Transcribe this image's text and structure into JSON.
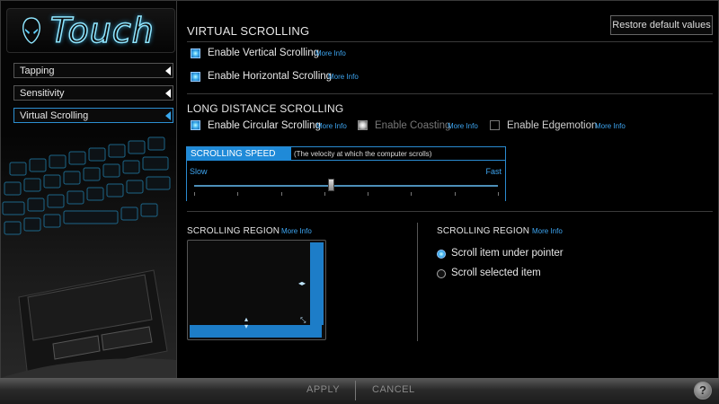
{
  "app": {
    "logo_text": "Touch"
  },
  "sidebar": {
    "items": [
      {
        "label": "Tapping"
      },
      {
        "label": "Sensitivity"
      },
      {
        "label": "Virtual Scrolling"
      }
    ]
  },
  "header": {
    "title": "VIRTUAL SCROLLING",
    "restore_label": "Restore default values"
  },
  "virtual": {
    "vertical": {
      "label": "Enable Vertical Scrolling",
      "checked": true,
      "more": "More Info"
    },
    "horizontal": {
      "label": "Enable Horizontal Scrolling",
      "checked": true,
      "more": "More Info"
    }
  },
  "long_distance": {
    "title": "LONG DISTANCE SCROLLING",
    "circular": {
      "label": "Enable Circular Scrolling",
      "checked": true,
      "more": "More Info"
    },
    "coasting": {
      "label": "Enable Coasting",
      "checked": true,
      "disabled": true,
      "more": "More Info"
    },
    "edgemotion": {
      "label": "Enable Edgemotion",
      "checked": false,
      "more": "More Info"
    }
  },
  "speed": {
    "title": "SCROLLING SPEED",
    "description": "(The velocity at which the computer scrolls)",
    "min_label": "Slow",
    "max_label": "Fast",
    "value": 0.45,
    "ticks": 8
  },
  "region_left": {
    "title": "SCROLLING REGION",
    "more": "More Info"
  },
  "region_right": {
    "title": "SCROLLING REGION",
    "more": "More Info",
    "options": [
      {
        "label": "Scroll item under pointer",
        "selected": true
      },
      {
        "label": "Scroll selected item",
        "selected": false
      }
    ]
  },
  "footer": {
    "apply_label": "APPLY",
    "cancel_label": "CANCEL",
    "help_label": "?"
  },
  "colors": {
    "accent": "#1f8ad8",
    "link": "#3ea6f2"
  }
}
